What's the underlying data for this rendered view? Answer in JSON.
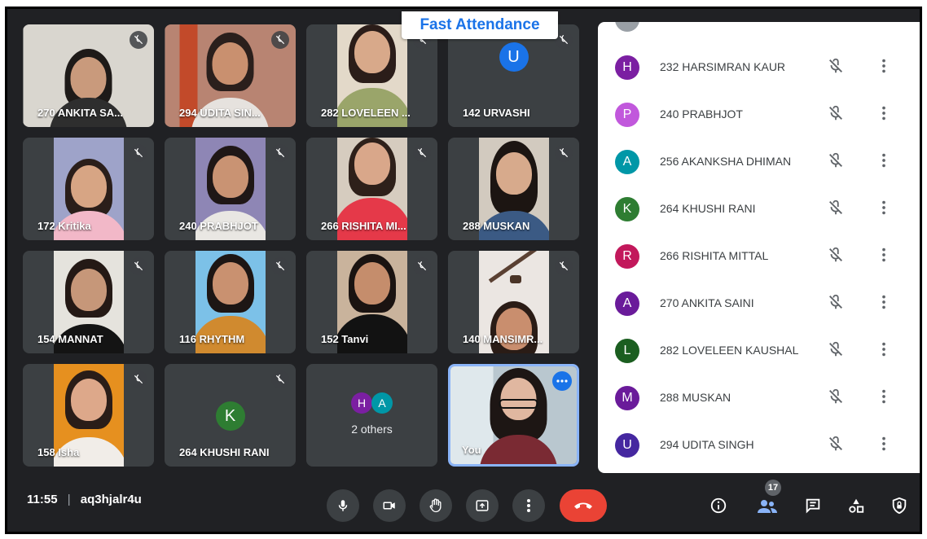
{
  "header": {
    "badge": "Fast Attendance"
  },
  "tiles": [
    {
      "name": "270 ANKITA SA...",
      "muted": true
    },
    {
      "name": "294 UDITA SIN...",
      "muted": true
    },
    {
      "name": "282 LOVELEEN ...",
      "muted": true
    },
    {
      "name": "142 URVASHI",
      "muted": true,
      "avatar_letter": "U"
    },
    {
      "name": "172 Kritika",
      "muted": true
    },
    {
      "name": "240 PRABHJOT",
      "muted": true
    },
    {
      "name": "266 RISHITA MI...",
      "muted": true
    },
    {
      "name": "288 MUSKAN",
      "muted": true
    },
    {
      "name": "154 MANNAT",
      "muted": true
    },
    {
      "name": "116 RHYTHM",
      "muted": true
    },
    {
      "name": "152 Tanvi",
      "muted": true
    },
    {
      "name": "140 MANSIMR...",
      "muted": true
    },
    {
      "name": "158 Isha",
      "muted": true
    },
    {
      "name": "264 KHUSHI RANI",
      "muted": true,
      "avatar_letter": "K"
    },
    {
      "name": "2 others",
      "avatar_letters": [
        "H",
        "A"
      ]
    },
    {
      "name": "You"
    }
  ],
  "participants_panel": {
    "rows": [
      {
        "letter": "H",
        "name": "232 HARSIMRAN KAUR",
        "color": "#7b1fa2"
      },
      {
        "letter": "P",
        "name": "240 PRABHJOT",
        "color": "#c158dc"
      },
      {
        "letter": "A",
        "name": "256 AKANKSHA DHIMAN",
        "color": "#0097a7"
      },
      {
        "letter": "K",
        "name": "264 KHUSHI RANI",
        "color": "#2e7d32"
      },
      {
        "letter": "R",
        "name": "266 RISHITA MITTAL",
        "color": "#c2185b"
      },
      {
        "letter": "A",
        "name": "270 ANKITA SAINI",
        "color": "#6a1b9a"
      },
      {
        "letter": "L",
        "name": "282 LOVELEEN KAUSHAL",
        "color": "#1b5e20"
      },
      {
        "letter": "M",
        "name": "288 MUSKAN",
        "color": "#6a1b9a"
      },
      {
        "letter": "U",
        "name": "294 UDITA SINGH",
        "color": "#4527a0"
      }
    ]
  },
  "bottom_bar": {
    "time": "11:55",
    "separator": "|",
    "meeting_code": "aq3hjalr4u",
    "people_count": "17"
  },
  "colors": {
    "end_call": "#ea4335",
    "self_border": "#8ab4f8",
    "accent": "#1a73e8"
  }
}
